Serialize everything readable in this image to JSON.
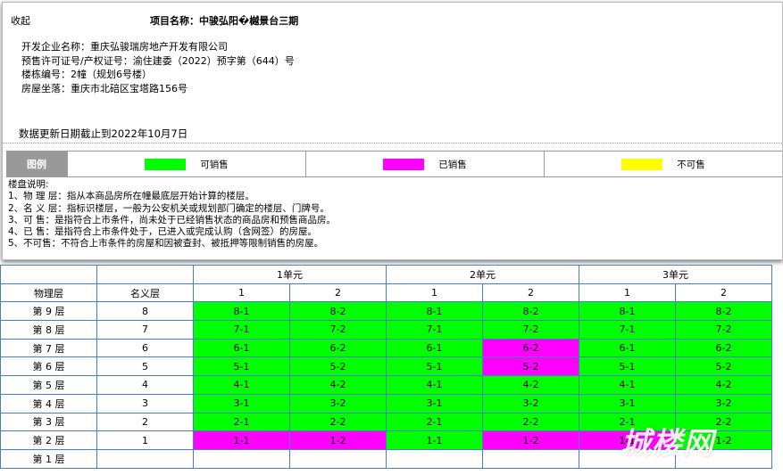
{
  "panel": {
    "collapse_label": "收起",
    "project_name": "项目名称：中骏弘阳�樾景台三期",
    "info_rows": [
      "开发企业名称：重庆弘骏瑞房地产开发有限公司",
      "预售许可证号/产权证号：渝住建委（2022）预字第（644）号",
      "楼栋编号：2幢（规划6号楼）",
      "房屋坐落：重庆市北碚区宝塔路156号"
    ],
    "update_date": "数据更新日期截止到2022年10月7日"
  },
  "legend": {
    "title": "图例",
    "items": [
      {
        "label": "可销售",
        "color": "#00ff00"
      },
      {
        "label": "已销售",
        "color": "#ff00ff"
      },
      {
        "label": "不可售",
        "color": "#ffff00"
      }
    ]
  },
  "notes": {
    "title": "楼盘说明:",
    "lines": [
      "1、物 理 层：指从本商品房所在幢最底层开始计算的楼层。",
      "2、名 义 层：指标识楼层，一般为公安机关或规划部门确定的楼层、门牌号。",
      "3、可 售：是指符合上市条件，尚未处于已经销售状态的商品房和预售商品房。",
      "4、已 售：是指符合上市条件处于，已进入或完成认购（含网签）的房屋。",
      "5、不可售：不符合上市条件的房屋和因被查封、被抵押等限制销售的房屋。"
    ]
  },
  "table": {
    "units": [
      "1单元",
      "2单元",
      "3单元"
    ],
    "col_physical": "物理层",
    "col_nominal": "名义层",
    "sub_cols": [
      "1",
      "2",
      "1",
      "2",
      "1",
      "2"
    ],
    "rows": [
      {
        "physical": "第 9 层",
        "nominal": "8",
        "cells": [
          [
            "8-1",
            "avail"
          ],
          [
            "8-2",
            "avail"
          ],
          [
            "8-1",
            "avail"
          ],
          [
            "8-2",
            "avail"
          ],
          [
            "8-1",
            "avail"
          ],
          [
            "8-2",
            "avail"
          ]
        ]
      },
      {
        "physical": "第 8 层",
        "nominal": "7",
        "cells": [
          [
            "7-1",
            "avail"
          ],
          [
            "7-2",
            "avail"
          ],
          [
            "7-1",
            "avail"
          ],
          [
            "7-2",
            "avail"
          ],
          [
            "7-1",
            "avail"
          ],
          [
            "7-2",
            "avail"
          ]
        ]
      },
      {
        "physical": "第 7 层",
        "nominal": "6",
        "cells": [
          [
            "6-1",
            "avail"
          ],
          [
            "6-2",
            "avail"
          ],
          [
            "6-1",
            "avail"
          ],
          [
            "6-2",
            "sold"
          ],
          [
            "6-1",
            "avail"
          ],
          [
            "6-2",
            "avail"
          ]
        ]
      },
      {
        "physical": "第 6 层",
        "nominal": "5",
        "cells": [
          [
            "5-1",
            "avail"
          ],
          [
            "5-2",
            "avail"
          ],
          [
            "5-1",
            "avail"
          ],
          [
            "5-2",
            "sold"
          ],
          [
            "5-1",
            "avail"
          ],
          [
            "5-2",
            "avail"
          ]
        ]
      },
      {
        "physical": "第 5 层",
        "nominal": "4",
        "cells": [
          [
            "4-1",
            "avail"
          ],
          [
            "4-2",
            "avail"
          ],
          [
            "4-1",
            "avail"
          ],
          [
            "4-2",
            "avail"
          ],
          [
            "4-1",
            "avail"
          ],
          [
            "4-2",
            "avail"
          ]
        ]
      },
      {
        "physical": "第 4 层",
        "nominal": "3",
        "cells": [
          [
            "3-1",
            "avail"
          ],
          [
            "3-2",
            "avail"
          ],
          [
            "3-1",
            "avail"
          ],
          [
            "3-2",
            "avail"
          ],
          [
            "3-1",
            "avail"
          ],
          [
            "3-2",
            "avail"
          ]
        ]
      },
      {
        "physical": "第 3 层",
        "nominal": "2",
        "cells": [
          [
            "2-1",
            "avail"
          ],
          [
            "2-2",
            "avail"
          ],
          [
            "2-1",
            "avail"
          ],
          [
            "2-2",
            "avail"
          ],
          [
            "2-1",
            "avail"
          ],
          [
            "2-2",
            "avail"
          ]
        ]
      },
      {
        "physical": "第 2 层",
        "nominal": "1",
        "cells": [
          [
            "1-1",
            "sold"
          ],
          [
            "1-2",
            "sold"
          ],
          [
            "1-1",
            "avail"
          ],
          [
            "1-2",
            "sold"
          ],
          [
            "1-1",
            "sold"
          ],
          [
            "1-2",
            "avail"
          ]
        ]
      },
      {
        "physical": "第 1 层",
        "nominal": "",
        "cells": [
          [
            "",
            "empty"
          ],
          [
            "",
            "empty"
          ],
          [
            "",
            "empty"
          ],
          [
            "",
            "empty"
          ],
          [
            "",
            "empty"
          ],
          [
            "",
            "empty"
          ]
        ]
      }
    ]
  },
  "watermark": "城楼网"
}
